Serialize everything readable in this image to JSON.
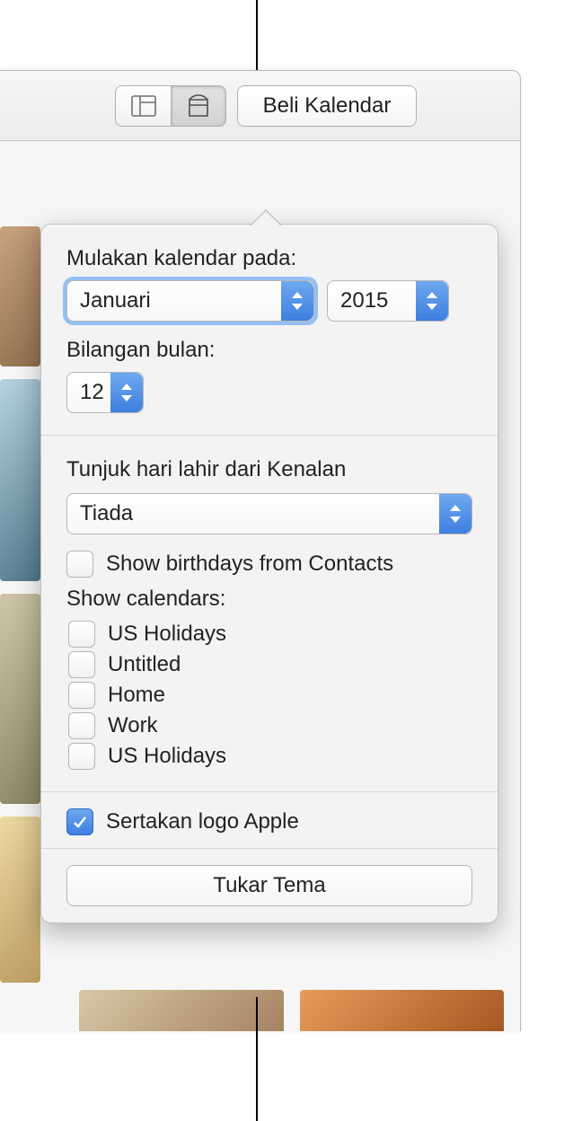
{
  "toolbar": {
    "buy_label": "Beli Kalendar"
  },
  "popover": {
    "start_label": "Mulakan kalendar pada:",
    "month_value": "Januari",
    "year_value": "2015",
    "num_months_label": "Bilangan bulan:",
    "num_months_value": "12",
    "birthdays_heading": "Tunjuk hari lahir dari Kenalan",
    "birthdays_select_value": "Tiada",
    "show_birthdays_label": "Show birthdays from Contacts",
    "show_calendars_label": "Show calendars:",
    "calendars": [
      {
        "label": "US Holidays"
      },
      {
        "label": "Untitled"
      },
      {
        "label": "Home"
      },
      {
        "label": "Work"
      },
      {
        "label": "US Holidays"
      }
    ],
    "include_logo_label": "Sertakan logo Apple",
    "change_theme_label": "Tukar Tema"
  }
}
